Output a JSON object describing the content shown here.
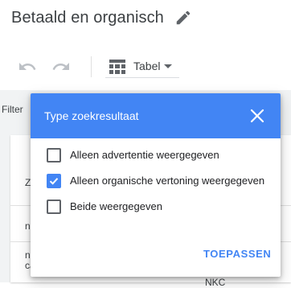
{
  "page": {
    "title": "Betaald en organisch"
  },
  "toolbar": {
    "undo_icon": "undo-icon",
    "redo_icon": "redo-icon",
    "view_icon": "table-grid-icon",
    "view_label": "Tabel"
  },
  "filter": {
    "label": "Filter"
  },
  "table": {
    "header_fragment": "Z",
    "row1_fragment": "nl",
    "row2_fragment_a": "nl",
    "row2_fragment_b": "ca",
    "footer_fragment": "NKC"
  },
  "dialog": {
    "title": "Type zoekresultaat",
    "options": [
      {
        "label": "Alleen advertentie weergegeven",
        "checked": false
      },
      {
        "label": "Alleen organische vertoning weergegeven",
        "checked": true
      },
      {
        "label": "Beide weergegeven",
        "checked": false
      }
    ],
    "apply_label": "TOEPASSEN"
  },
  "colors": {
    "accent": "#4285f4",
    "background_strip": "#f1f3f4"
  }
}
